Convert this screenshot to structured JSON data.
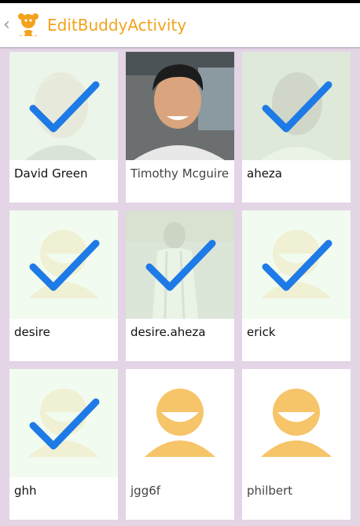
{
  "app": {
    "title": "EditBuddyActivity"
  },
  "colors": {
    "accent": "#f2a31b",
    "check": "#1e7ae6",
    "background": "#e3d4e6",
    "selected_overlay": "#eefaec",
    "avatar_placeholder": "#f6c469"
  },
  "buddies": [
    {
      "name": "David Green",
      "selected": true,
      "avatar": "photo-man-gray"
    },
    {
      "name": "Timothy Mcguire",
      "selected": false,
      "avatar": "photo-young-man"
    },
    {
      "name": "aheza",
      "selected": true,
      "avatar": "photo-woman"
    },
    {
      "name": "desire",
      "selected": true,
      "avatar": "default-avatar"
    },
    {
      "name": "desire.aheza",
      "selected": true,
      "avatar": "photo-man-robe"
    },
    {
      "name": "erick",
      "selected": true,
      "avatar": "default-avatar"
    },
    {
      "name": "ghh",
      "selected": true,
      "avatar": "default-avatar"
    },
    {
      "name": "jgg6f",
      "selected": false,
      "avatar": "default-avatar"
    },
    {
      "name": "philbert",
      "selected": false,
      "avatar": "default-avatar"
    }
  ]
}
